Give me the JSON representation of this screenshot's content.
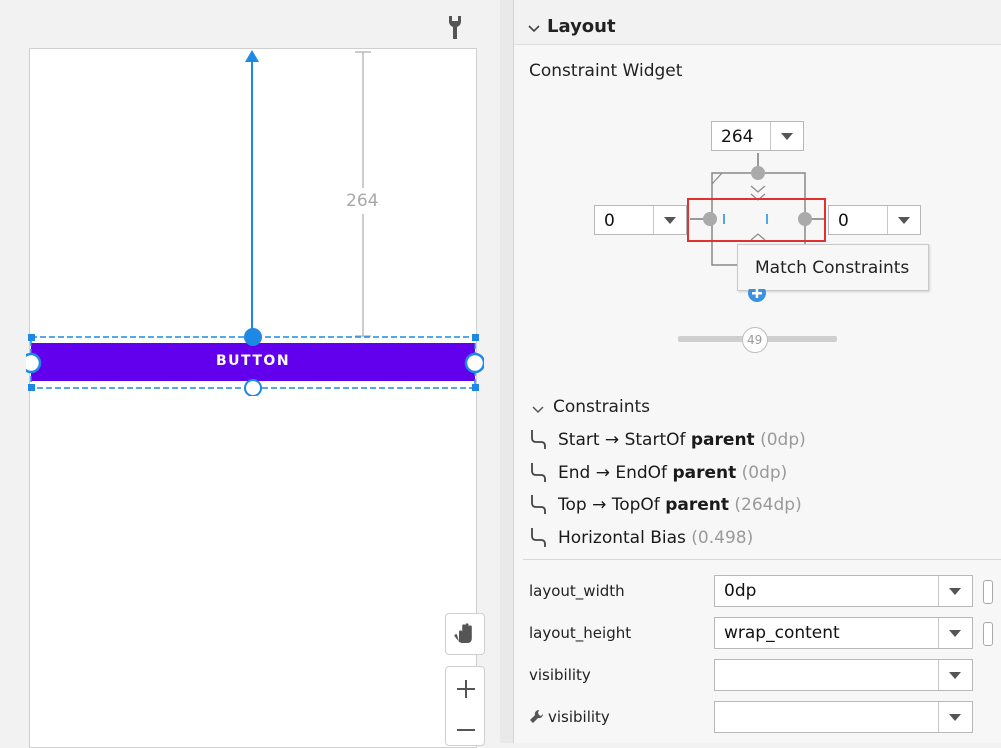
{
  "design": {
    "distance_label": "264",
    "button_text": "BUTTON"
  },
  "panel": {
    "section_title": "Layout",
    "widget_title": "Constraint Widget",
    "top_margin": "264",
    "left_margin": "0",
    "right_margin": "0",
    "tooltip": "Match Constraints",
    "bias_value": "49"
  },
  "constraints": {
    "title": "Constraints",
    "items": [
      {
        "label": "Start → StartOf ",
        "target": "parent",
        "value": "(0dp)"
      },
      {
        "label": "End → EndOf ",
        "target": "parent",
        "value": "(0dp)"
      },
      {
        "label": "Top → TopOf ",
        "target": "parent",
        "value": "(264dp)"
      },
      {
        "label": "Horizontal Bias",
        "target": "",
        "value": "(0.498)"
      }
    ]
  },
  "attributes": {
    "layout_width": {
      "label": "layout_width",
      "value": "0dp"
    },
    "layout_height": {
      "label": "layout_height",
      "value": "wrap_content"
    },
    "visibility": {
      "label": "visibility",
      "value": ""
    },
    "tools_visibility": {
      "label": "visibility",
      "value": ""
    }
  },
  "colors": {
    "accent": "#1e88e5",
    "button": "#6200ee",
    "highlight": "#e03030"
  }
}
